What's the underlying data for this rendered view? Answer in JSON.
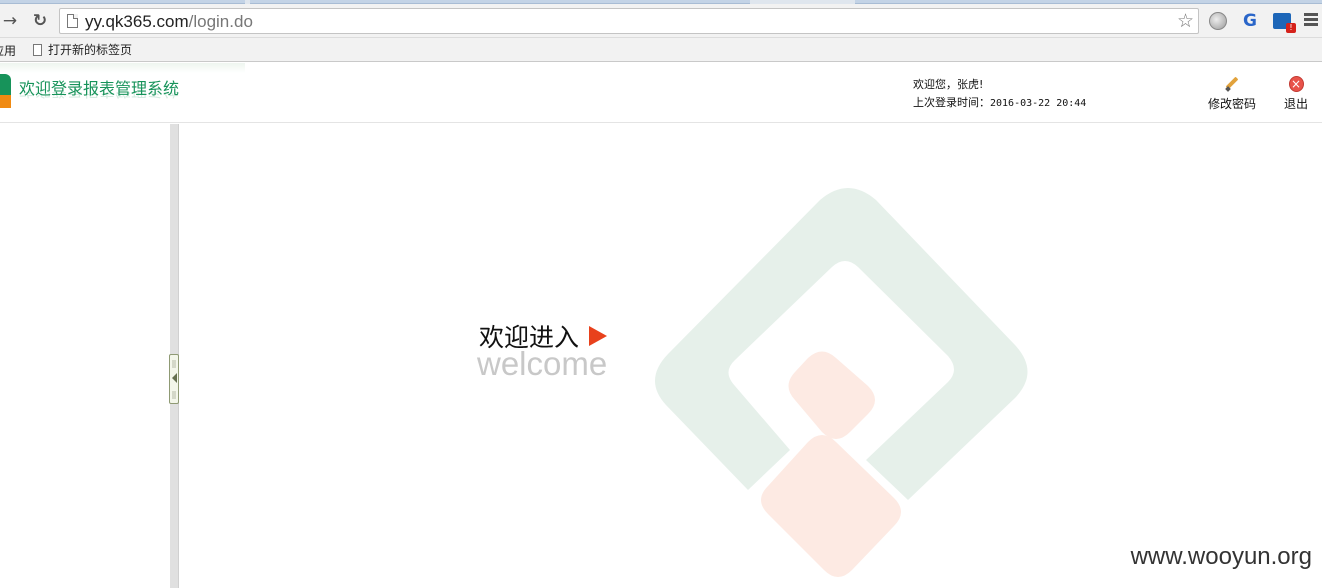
{
  "browser": {
    "url_host": "yy.qk365.com",
    "url_path": "/login.do",
    "bookmarks": {
      "apps_label": "应用",
      "new_tab_label": "打开新的标签页"
    },
    "ext_badge": "!"
  },
  "header": {
    "app_title": "欢迎登录报表管理系统",
    "greeting": "欢迎您，张虎!",
    "last_login_label": "上次登录时间：",
    "last_login_time": "2016-03-22 20:44",
    "change_password_label": "修改密码",
    "logout_label": "退出"
  },
  "content": {
    "welcome_cn": "欢迎进入",
    "welcome_en": "welcome"
  },
  "watermark": "www.wooyun.org",
  "colors": {
    "brand_green": "#17935a",
    "brand_orange": "#f08a12",
    "accent_red": "#e8411c",
    "watermark_green": "#e6f0ea",
    "watermark_peach": "#fdeae3"
  },
  "icons": {
    "back": "back-arrow-icon",
    "reload": "reload-icon",
    "bookmark_star": "star-icon",
    "edit": "pencil-icon",
    "logout": "close-circle-icon"
  }
}
